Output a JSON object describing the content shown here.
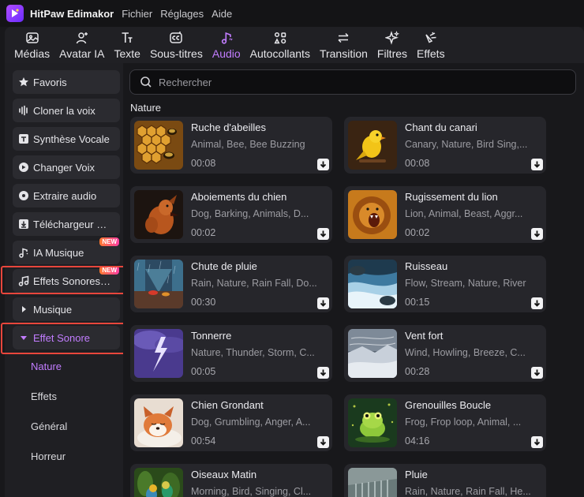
{
  "app": {
    "name": "HitPaw Edimakor",
    "menu": [
      "Fichier",
      "Réglages",
      "Aide"
    ]
  },
  "toolbar": {
    "tabs": [
      {
        "label": "Médias",
        "icon": "media-icon",
        "active": false
      },
      {
        "label": "Avatar IA",
        "icon": "avatar-icon",
        "active": false
      },
      {
        "label": "Texte",
        "icon": "text-icon",
        "active": false
      },
      {
        "label": "Sous-titres",
        "icon": "subtitles-icon",
        "active": false
      },
      {
        "label": "Audio",
        "icon": "music-note-icon",
        "active": true
      },
      {
        "label": "Autocollants",
        "icon": "stickers-icon",
        "active": false
      },
      {
        "label": "Transition",
        "icon": "transition-icon",
        "active": false
      },
      {
        "label": "Filtres",
        "icon": "filters-icon",
        "active": false
      },
      {
        "label": "Effets",
        "icon": "effects-icon",
        "active": false
      }
    ]
  },
  "sidebar": {
    "items": [
      {
        "label": "Favoris",
        "icon": "star-icon",
        "badge": ""
      },
      {
        "label": "Cloner la voix",
        "icon": "voice-clone-icon",
        "badge": ""
      },
      {
        "label": "Synthèse Vocale",
        "icon": "text-to-speech-icon",
        "badge": ""
      },
      {
        "label": "Changer Voix",
        "icon": "voice-changer-icon",
        "badge": ""
      },
      {
        "label": "Extraire audio",
        "icon": "extract-audio-icon",
        "badge": ""
      },
      {
        "label": "Téléchargeur audio",
        "icon": "download-icon",
        "badge": ""
      },
      {
        "label": "IA Musique",
        "icon": "ai-music-icon",
        "badge": "NEW"
      },
      {
        "label": "Effets Sonores IA",
        "icon": "ai-sound-icon",
        "badge": "NEW"
      },
      {
        "label": "Musique",
        "icon": "caret-right-icon",
        "badge": ""
      },
      {
        "label": "Effet Sonore",
        "icon": "caret-down-icon",
        "badge": ""
      }
    ],
    "sub_items": [
      {
        "label": "Nature",
        "active": true
      },
      {
        "label": "Effets",
        "active": false
      },
      {
        "label": "Général",
        "active": false
      },
      {
        "label": "Horreur",
        "active": false
      }
    ]
  },
  "search": {
    "placeholder": "Rechercher"
  },
  "section_title": "Nature",
  "sounds": [
    {
      "title": "Ruche d'abeilles",
      "tags": "Animal, Bee, Bee Buzzing",
      "duration": "00:08",
      "thumb": "beehive"
    },
    {
      "title": "Chant du canari",
      "tags": "Canary, Nature, Bird Sing,...",
      "duration": "00:08",
      "thumb": "canary"
    },
    {
      "title": "Aboiements du chien",
      "tags": "Dog, Barking, Animals, D...",
      "duration": "00:02",
      "thumb": "dog"
    },
    {
      "title": "Rugissement du lion",
      "tags": "Lion, Animal, Beast, Aggr...",
      "duration": "00:02",
      "thumb": "lion"
    },
    {
      "title": "Chute de pluie",
      "tags": "Rain, Nature, Rain Fall, Do...",
      "duration": "00:30",
      "thumb": "rain-street"
    },
    {
      "title": "Ruisseau",
      "tags": "Flow, Stream, Nature, River",
      "duration": "00:15",
      "thumb": "stream"
    },
    {
      "title": "Tonnerre",
      "tags": "Nature, Thunder, Storm, C...",
      "duration": "00:05",
      "thumb": "thunder"
    },
    {
      "title": "Vent fort",
      "tags": "Wind, Howling, Breeze, C...",
      "duration": "00:28",
      "thumb": "wind"
    },
    {
      "title": "Chien Grondant",
      "tags": "Dog, Grumbling, Anger, A...",
      "duration": "00:54",
      "thumb": "puppy"
    },
    {
      "title": "Grenouilles Boucle",
      "tags": "Frog, Frop loop, Animal, ...",
      "duration": "04:16",
      "thumb": "frog"
    },
    {
      "title": "Oiseaux Matin",
      "tags": "Morning, Bird, Singing, Cl...",
      "duration": "",
      "thumb": "birds"
    },
    {
      "title": "Pluie",
      "tags": "Rain, Nature, Rain Fall, He...",
      "duration": "",
      "thumb": "rain-roof"
    }
  ],
  "colors": {
    "accent": "#c27dff",
    "highlight": "#e8463c",
    "panel": "#202024",
    "card": "#26262b"
  }
}
